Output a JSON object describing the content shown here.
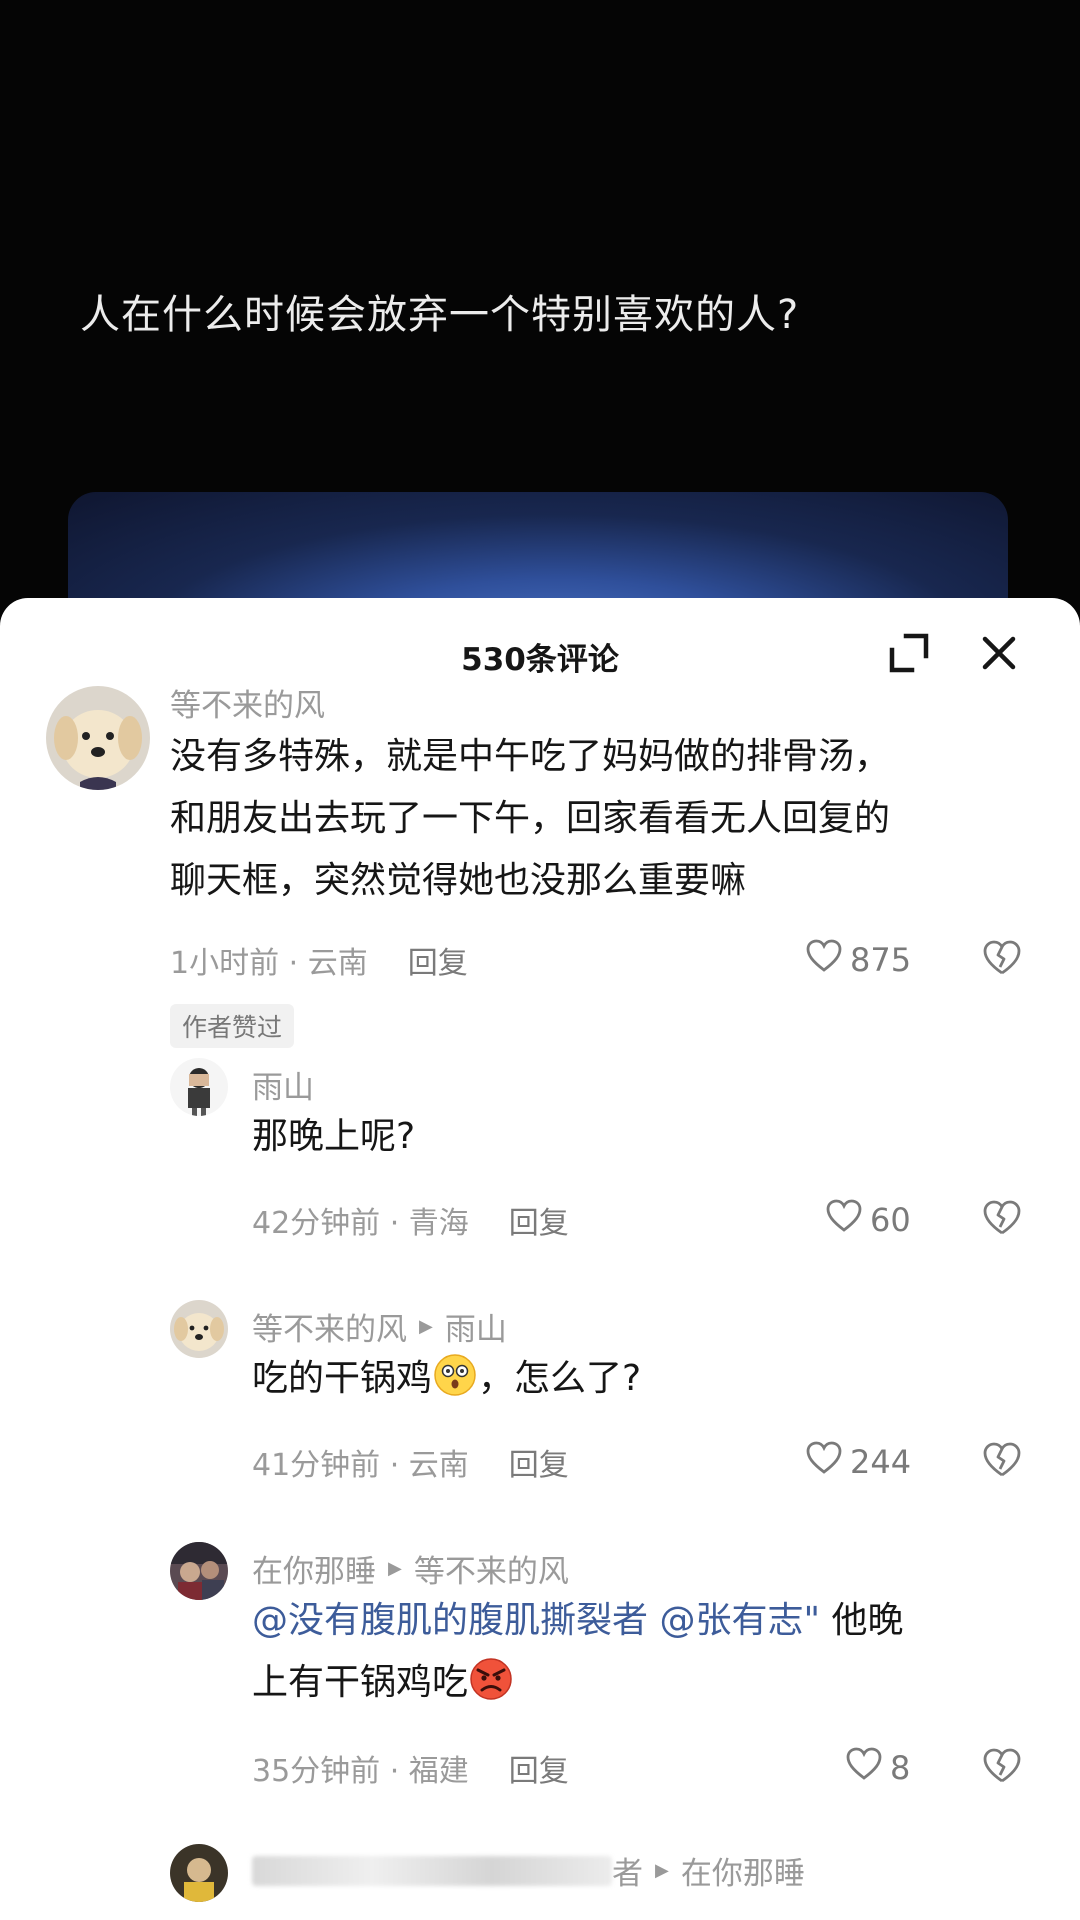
{
  "video": {
    "caption": "人在什么时候会放弃一个特别喜欢的人?"
  },
  "sheet": {
    "title": "530条评论"
  },
  "comments": [
    {
      "author": "等不来的风",
      "text_lines": [
        "没有多特殊，就是中午吃了妈妈做的排骨汤，",
        "和朋友出去玩了一下午，回家看看无人回复的",
        "聊天框，突然觉得她也没那么重要嘛"
      ],
      "meta": "1小时前 · 云南",
      "reply_label": "回复",
      "likes": "875",
      "badge": "作者赞过"
    },
    {
      "author": "雨山",
      "text": "那晚上呢?",
      "meta": "42分钟前 · 青海",
      "reply_label": "回复",
      "likes": "60"
    },
    {
      "author": "等不来的风",
      "reply_to": "雨山",
      "text_before": "吃的干锅鸡",
      "text_after": "，怎么了?",
      "meta": "41分钟前 · 云南",
      "reply_label": "回复",
      "likes": "244"
    },
    {
      "author": "在你那睡",
      "reply_to": "等不来的风",
      "mention1": "@没有腹肌的腹肌撕裂者",
      "mention2": "@张有志\"",
      "text_line1_rest": " 他晚",
      "text_line2": "上有干锅鸡吃",
      "meta": "35分钟前 · 福建",
      "reply_label": "回复",
      "likes": "8"
    },
    {
      "author_visible": "者",
      "reply_to": "在你那睡"
    }
  ],
  "colors": {
    "accent_mention": "#3d5c9a",
    "text_primary": "#161616",
    "text_secondary": "#9a9a9a"
  }
}
